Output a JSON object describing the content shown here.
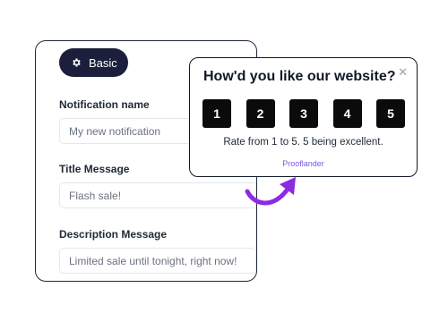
{
  "form": {
    "tab_label": "Basic",
    "tab_icon": "gear-icon",
    "fields": [
      {
        "label": "Notification name",
        "placeholder": "My new notification"
      },
      {
        "label": "Title Message",
        "value": "Flash sale!"
      },
      {
        "label": "Description Message",
        "value": "Limited sale until tonight, right now!"
      }
    ]
  },
  "popup": {
    "title": "How'd you like our website?",
    "close_icon": "close-icon",
    "ratings": [
      "1",
      "2",
      "3",
      "4",
      "5"
    ],
    "caption": "Rate from 1 to 5. 5 being excellent.",
    "brand": "Prooflander"
  },
  "colors": {
    "pill_bg": "#1b1f3b",
    "rating_bg": "#0b0b0b",
    "brand": "#7c5ae0",
    "arrow": "#8b2be2"
  }
}
